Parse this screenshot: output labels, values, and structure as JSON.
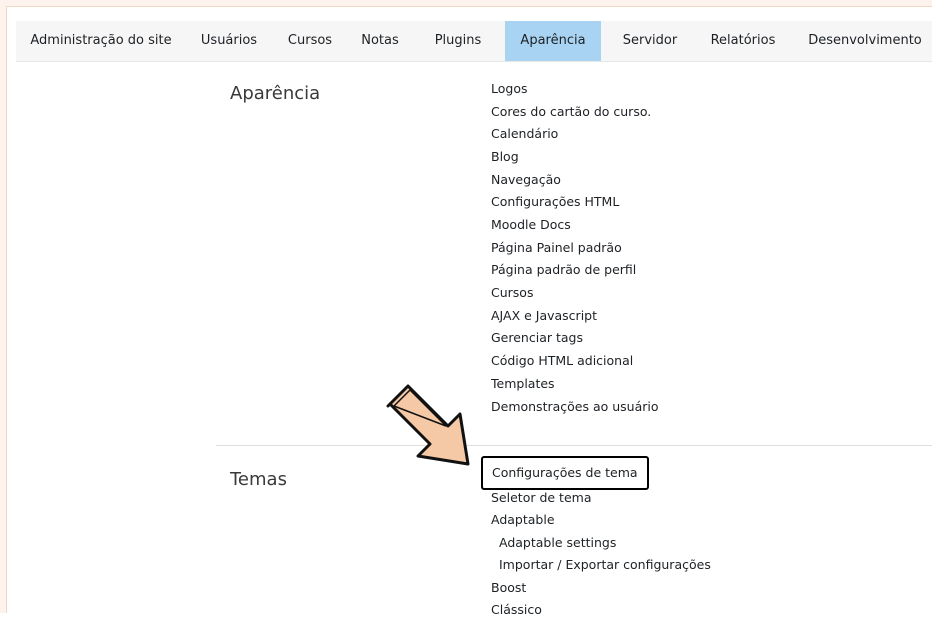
{
  "tabs": [
    {
      "label": "Administração do site",
      "active": false
    },
    {
      "label": "Usuários",
      "active": false
    },
    {
      "label": "Cursos",
      "active": false
    },
    {
      "label": "Notas",
      "active": false
    },
    {
      "label": "Plugins",
      "active": false
    },
    {
      "label": "Aparência",
      "active": true
    },
    {
      "label": "Servidor",
      "active": false
    },
    {
      "label": "Relatórios",
      "active": false
    },
    {
      "label": "Desenvolvimento",
      "active": false
    }
  ],
  "sections": {
    "aparencia": {
      "title": "Aparência",
      "links": [
        "Logos",
        "Cores do cartão do curso.",
        "Calendário",
        "Blog",
        "Navegação",
        "Configurações HTML",
        "Moodle Docs",
        "Página Painel padrão",
        "Página padrão de perfil",
        "Cursos",
        "AJAX e Javascript",
        "Gerenciar tags",
        "Código HTML adicional",
        "Templates",
        "Demonstrações ao usuário"
      ]
    },
    "temas": {
      "title": "Temas",
      "highlighted_link": "Configurações de tema",
      "links": [
        "Seletor de tema",
        "Adaptable",
        "Adaptable settings",
        "Importar / Exportar configurações",
        "Boost",
        "Clássico"
      ]
    }
  },
  "colors": {
    "active_tab": "#a9d3f2",
    "arrow_fill": "#f6c9a6",
    "highlight_border": "#000000"
  },
  "icons": {
    "pointer": "arrow-pointer-icon"
  }
}
